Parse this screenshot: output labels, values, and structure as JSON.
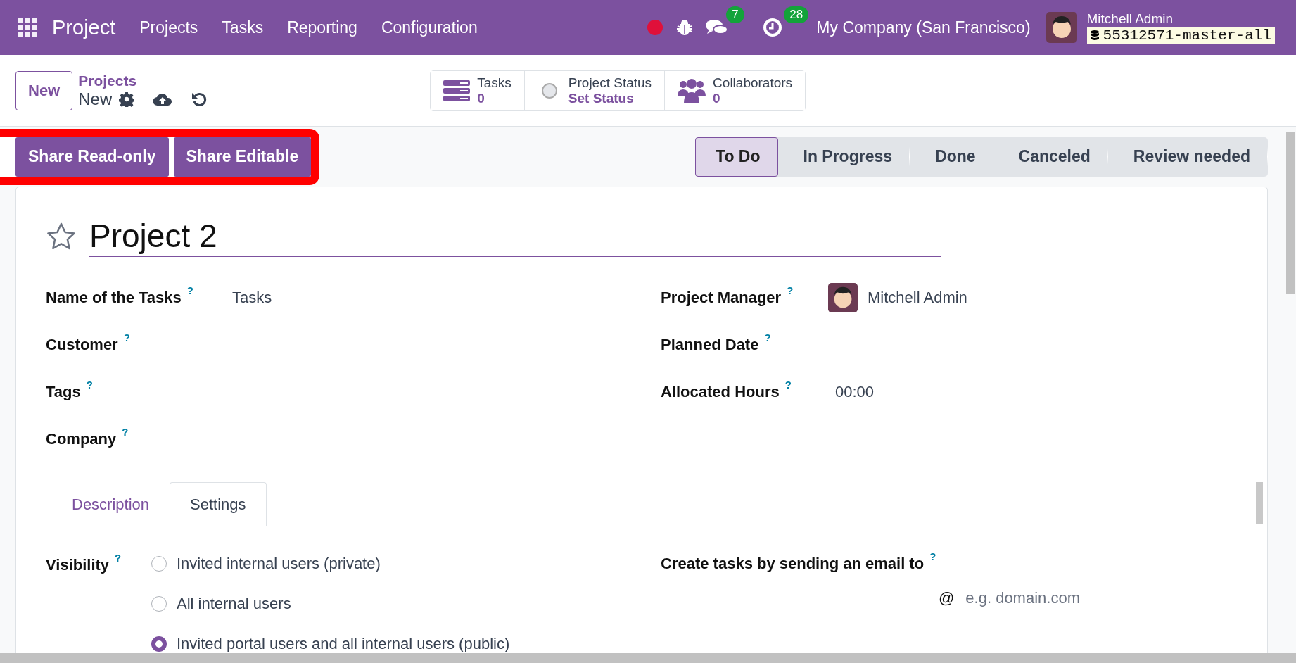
{
  "navbar": {
    "app_name": "Project",
    "menu": [
      "Projects",
      "Tasks",
      "Reporting",
      "Configuration"
    ],
    "messages_count": "7",
    "activities_count": "28",
    "company": "My Company (San Francisco)",
    "user_name": "Mitchell Admin",
    "database": "55312571-master-all"
  },
  "control_panel": {
    "new_button": "New",
    "breadcrumb": "Projects",
    "current": "New"
  },
  "smart_buttons": [
    {
      "kind": "tasks",
      "label": "Tasks",
      "value": "0"
    },
    {
      "kind": "status",
      "label": "Project Status",
      "value": "Set Status"
    },
    {
      "kind": "people",
      "label": "Collaborators",
      "value": "0"
    }
  ],
  "share_buttons": {
    "highlighted": true,
    "labels": [
      "Share Read-only",
      "Share Editable"
    ]
  },
  "stages": [
    {
      "label": "To Do",
      "selected": true
    },
    {
      "label": "In Progress",
      "selected": false
    },
    {
      "label": "Done",
      "selected": false
    },
    {
      "label": "Canceled",
      "selected": false
    },
    {
      "label": "Review needed",
      "selected": false
    }
  ],
  "form": {
    "favorite": false,
    "title": "Project 2",
    "left_fields": [
      {
        "label": "Name of the Tasks",
        "help": "?",
        "value": "Tasks"
      },
      {
        "label": "Customer",
        "help": "?"
      },
      {
        "label": "Tags",
        "help": "?"
      },
      {
        "label": "Company",
        "help": "?"
      }
    ],
    "right_fields": [
      {
        "label": "Project Manager",
        "help": "?",
        "kind": "user",
        "value": "Mitchell Admin"
      },
      {
        "label": "Planned Date",
        "help": "?",
        "kind": "text"
      },
      {
        "label": "Allocated Hours",
        "help": "?",
        "kind": "text",
        "value": "00:00"
      }
    ],
    "tabs": [
      {
        "label": "Description",
        "selected": false
      },
      {
        "label": "Settings",
        "selected": true
      }
    ],
    "visibility": {
      "label": "Visibility",
      "help": "?",
      "options": [
        {
          "label": "Invited internal users (private)",
          "selected": false
        },
        {
          "label": "All internal users",
          "selected": false
        },
        {
          "label": "Invited portal users and all internal users (public)",
          "selected": true
        }
      ]
    },
    "email": {
      "label": "Create tasks by sending an email to",
      "help": "?",
      "at": "@",
      "placeholder": "e.g. domain.com"
    }
  }
}
